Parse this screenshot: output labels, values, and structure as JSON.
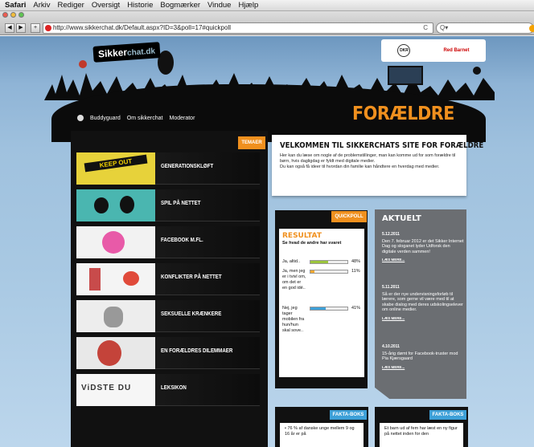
{
  "menubar": {
    "items": [
      "Safari",
      "Arkiv",
      "Rediger",
      "Oversigt",
      "Historie",
      "Bogmærker",
      "Vindue",
      "Hjælp"
    ]
  },
  "toolbar": {
    "back": "◀",
    "forward": "▶",
    "add": "+",
    "url": "http://www.sikkerchat.dk/Default.aspx?ID=3&poll=17#quickpoll",
    "reload": "C",
    "search_placeholder": "Q▾"
  },
  "site": {
    "logo": "Sikker",
    "logo_suffix": "chat.dk",
    "partners": {
      "dkr": "DKR",
      "redbarnet": "Red Barnet"
    },
    "nav": [
      "Buddyguard",
      "Om sikkerchat",
      "Moderator"
    ],
    "section_title": "FORÆLDRE"
  },
  "themes": {
    "tag": "TEMAER",
    "items": [
      {
        "label": "GENERATIONSKLØFT",
        "thumb_text": "KEEP OUT"
      },
      {
        "label": "SPIL PÅ NETTET",
        "thumb_text": ""
      },
      {
        "label": "FACEBOOK M.FL.",
        "thumb_text": ""
      },
      {
        "label": "KONFLIKTER PÅ NETTET",
        "thumb_text": ""
      },
      {
        "label": "SEKSUELLE KRÆNKERE",
        "thumb_text": ""
      },
      {
        "label": "EN FORÆLDRES DILEMMAER",
        "thumb_text": ""
      },
      {
        "label": "LEKSIKON",
        "thumb_text": "ViDSTE DU"
      }
    ]
  },
  "welcome": {
    "title": "VELKOMMEN TIL SIKKERCHATS SITE FOR FORÆLDRE",
    "body1": "Her kan du læse om nogle af de problemstillinger, man kan komme ud for som forældre til børn, hvis dagligdag er fyldt med digitale medier.",
    "body2": "Du kan også få ideer til hvordan din familie kan håndtere en hverdag med medier."
  },
  "poll": {
    "tag": "QUICKPOLL",
    "title": "RESULTAT",
    "subtitle": "Se hvad de andre har svaret",
    "options": [
      {
        "text": "Ja, altid..",
        "pct_label": "48%",
        "value": 48,
        "color": "#9bc53d"
      },
      {
        "text": "Ja, men jeg er i tvivl om, om det er en god idé..",
        "pct_label": "11%",
        "value": 11,
        "color": "#f0a830"
      },
      {
        "text": "Nej, jeg tager mobilen fra hun/hun skal sove..",
        "pct_label": "41%",
        "value": 41,
        "color": "#3da0d8"
      }
    ]
  },
  "aktuelt": {
    "title": "AKTUELT",
    "more": "LÆS MERE...",
    "news": [
      {
        "date": "5.12.2011",
        "text": "Den 7. februar 2012 er det Sikker Internet Dag og sloganet lyder Udforsk den digitale verden sammen!"
      },
      {
        "date": "5.11.2011",
        "text": "Så er der nye undervisningsforløb til lærere, som gerne vil være med til at skabe dialog med deres udskolingselever om online medier."
      },
      {
        "date": "4.10.2011",
        "text": "15-årig dømt for Facebook-truster mod Pia Kjærsgaard"
      }
    ]
  },
  "fakta": {
    "tag": "FAKTA-BOKS",
    "box1": "• 76 % af danske unge mellem 9 og 16 år er på",
    "box2": "Et barn ud af fem har læst en ny figur på nettet inden for den"
  }
}
